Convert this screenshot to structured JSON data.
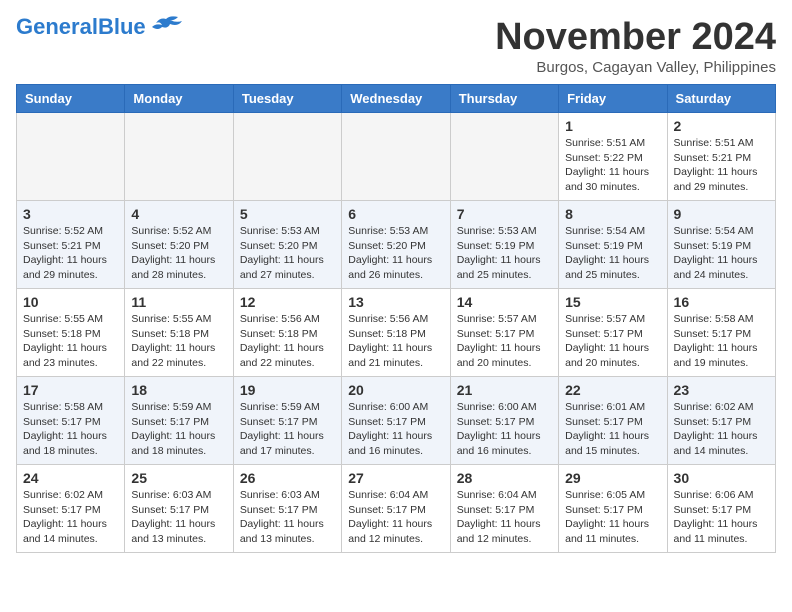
{
  "header": {
    "logo_general": "General",
    "logo_blue": "Blue",
    "month_title": "November 2024",
    "location": "Burgos, Cagayan Valley, Philippines"
  },
  "days_of_week": [
    "Sunday",
    "Monday",
    "Tuesday",
    "Wednesday",
    "Thursday",
    "Friday",
    "Saturday"
  ],
  "weeks": [
    {
      "days": [
        {
          "date": "",
          "empty": true
        },
        {
          "date": "",
          "empty": true
        },
        {
          "date": "",
          "empty": true
        },
        {
          "date": "",
          "empty": true
        },
        {
          "date": "",
          "empty": true
        },
        {
          "date": "1",
          "sunrise": "Sunrise: 5:51 AM",
          "sunset": "Sunset: 5:22 PM",
          "daylight": "Daylight: 11 hours and 30 minutes."
        },
        {
          "date": "2",
          "sunrise": "Sunrise: 5:51 AM",
          "sunset": "Sunset: 5:21 PM",
          "daylight": "Daylight: 11 hours and 29 minutes."
        }
      ]
    },
    {
      "alt": true,
      "days": [
        {
          "date": "3",
          "sunrise": "Sunrise: 5:52 AM",
          "sunset": "Sunset: 5:21 PM",
          "daylight": "Daylight: 11 hours and 29 minutes."
        },
        {
          "date": "4",
          "sunrise": "Sunrise: 5:52 AM",
          "sunset": "Sunset: 5:20 PM",
          "daylight": "Daylight: 11 hours and 28 minutes."
        },
        {
          "date": "5",
          "sunrise": "Sunrise: 5:53 AM",
          "sunset": "Sunset: 5:20 PM",
          "daylight": "Daylight: 11 hours and 27 minutes."
        },
        {
          "date": "6",
          "sunrise": "Sunrise: 5:53 AM",
          "sunset": "Sunset: 5:20 PM",
          "daylight": "Daylight: 11 hours and 26 minutes."
        },
        {
          "date": "7",
          "sunrise": "Sunrise: 5:53 AM",
          "sunset": "Sunset: 5:19 PM",
          "daylight": "Daylight: 11 hours and 25 minutes."
        },
        {
          "date": "8",
          "sunrise": "Sunrise: 5:54 AM",
          "sunset": "Sunset: 5:19 PM",
          "daylight": "Daylight: 11 hours and 25 minutes."
        },
        {
          "date": "9",
          "sunrise": "Sunrise: 5:54 AM",
          "sunset": "Sunset: 5:19 PM",
          "daylight": "Daylight: 11 hours and 24 minutes."
        }
      ]
    },
    {
      "days": [
        {
          "date": "10",
          "sunrise": "Sunrise: 5:55 AM",
          "sunset": "Sunset: 5:18 PM",
          "daylight": "Daylight: 11 hours and 23 minutes."
        },
        {
          "date": "11",
          "sunrise": "Sunrise: 5:55 AM",
          "sunset": "Sunset: 5:18 PM",
          "daylight": "Daylight: 11 hours and 22 minutes."
        },
        {
          "date": "12",
          "sunrise": "Sunrise: 5:56 AM",
          "sunset": "Sunset: 5:18 PM",
          "daylight": "Daylight: 11 hours and 22 minutes."
        },
        {
          "date": "13",
          "sunrise": "Sunrise: 5:56 AM",
          "sunset": "Sunset: 5:18 PM",
          "daylight": "Daylight: 11 hours and 21 minutes."
        },
        {
          "date": "14",
          "sunrise": "Sunrise: 5:57 AM",
          "sunset": "Sunset: 5:17 PM",
          "daylight": "Daylight: 11 hours and 20 minutes."
        },
        {
          "date": "15",
          "sunrise": "Sunrise: 5:57 AM",
          "sunset": "Sunset: 5:17 PM",
          "daylight": "Daylight: 11 hours and 20 minutes."
        },
        {
          "date": "16",
          "sunrise": "Sunrise: 5:58 AM",
          "sunset": "Sunset: 5:17 PM",
          "daylight": "Daylight: 11 hours and 19 minutes."
        }
      ]
    },
    {
      "alt": true,
      "days": [
        {
          "date": "17",
          "sunrise": "Sunrise: 5:58 AM",
          "sunset": "Sunset: 5:17 PM",
          "daylight": "Daylight: 11 hours and 18 minutes."
        },
        {
          "date": "18",
          "sunrise": "Sunrise: 5:59 AM",
          "sunset": "Sunset: 5:17 PM",
          "daylight": "Daylight: 11 hours and 18 minutes."
        },
        {
          "date": "19",
          "sunrise": "Sunrise: 5:59 AM",
          "sunset": "Sunset: 5:17 PM",
          "daylight": "Daylight: 11 hours and 17 minutes."
        },
        {
          "date": "20",
          "sunrise": "Sunrise: 6:00 AM",
          "sunset": "Sunset: 5:17 PM",
          "daylight": "Daylight: 11 hours and 16 minutes."
        },
        {
          "date": "21",
          "sunrise": "Sunrise: 6:00 AM",
          "sunset": "Sunset: 5:17 PM",
          "daylight": "Daylight: 11 hours and 16 minutes."
        },
        {
          "date": "22",
          "sunrise": "Sunrise: 6:01 AM",
          "sunset": "Sunset: 5:17 PM",
          "daylight": "Daylight: 11 hours and 15 minutes."
        },
        {
          "date": "23",
          "sunrise": "Sunrise: 6:02 AM",
          "sunset": "Sunset: 5:17 PM",
          "daylight": "Daylight: 11 hours and 14 minutes."
        }
      ]
    },
    {
      "days": [
        {
          "date": "24",
          "sunrise": "Sunrise: 6:02 AM",
          "sunset": "Sunset: 5:17 PM",
          "daylight": "Daylight: 11 hours and 14 minutes."
        },
        {
          "date": "25",
          "sunrise": "Sunrise: 6:03 AM",
          "sunset": "Sunset: 5:17 PM",
          "daylight": "Daylight: 11 hours and 13 minutes."
        },
        {
          "date": "26",
          "sunrise": "Sunrise: 6:03 AM",
          "sunset": "Sunset: 5:17 PM",
          "daylight": "Daylight: 11 hours and 13 minutes."
        },
        {
          "date": "27",
          "sunrise": "Sunrise: 6:04 AM",
          "sunset": "Sunset: 5:17 PM",
          "daylight": "Daylight: 11 hours and 12 minutes."
        },
        {
          "date": "28",
          "sunrise": "Sunrise: 6:04 AM",
          "sunset": "Sunset: 5:17 PM",
          "daylight": "Daylight: 11 hours and 12 minutes."
        },
        {
          "date": "29",
          "sunrise": "Sunrise: 6:05 AM",
          "sunset": "Sunset: 5:17 PM",
          "daylight": "Daylight: 11 hours and 11 minutes."
        },
        {
          "date": "30",
          "sunrise": "Sunrise: 6:06 AM",
          "sunset": "Sunset: 5:17 PM",
          "daylight": "Daylight: 11 hours and 11 minutes."
        }
      ]
    }
  ]
}
